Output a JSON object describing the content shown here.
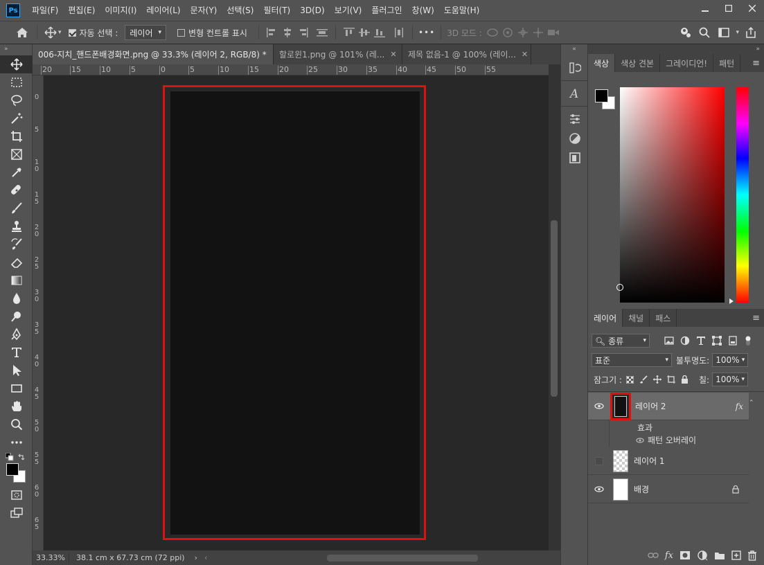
{
  "app": {
    "logo": "Ps"
  },
  "menu": [
    "파일(F)",
    "편집(E)",
    "이미지(I)",
    "레이어(L)",
    "문자(Y)",
    "선택(S)",
    "필터(T)",
    "3D(D)",
    "보기(V)",
    "플러그인",
    "창(W)",
    "도움말(H)"
  ],
  "options": {
    "auto_select_label": "자동 선택 :",
    "auto_select_checked": true,
    "auto_select_target": "레이어",
    "transform_label": "변형 컨트롤 표시",
    "transform_checked": false,
    "more_label": "•••",
    "mode_3d_label": "3D 모드 :"
  },
  "tabs": [
    {
      "title": "006-지치_핸드폰배경화면.png @ 33.3% (레이어 2, RGB/8) *",
      "active": true
    },
    {
      "title": "할로윈1.png @ 101% (레...",
      "active": false
    },
    {
      "title": "제목 없음-1 @ 100% (레이...",
      "active": false
    }
  ],
  "ruler_top": [
    "20",
    "15",
    "10",
    "5",
    "0",
    "5",
    "10",
    "15",
    "20",
    "25",
    "30",
    "35",
    "40",
    "45",
    "50",
    "55"
  ],
  "ruler_left": [
    "0",
    "5",
    "1 0",
    "1 5",
    "2 0",
    "2 5",
    "3 0",
    "3 5",
    "4 0",
    "4 5",
    "5 0",
    "5 5",
    "6 0",
    "6 5"
  ],
  "status": {
    "zoom": "33.33%",
    "size": "38.1 cm x 67.73 cm (72 ppi)"
  },
  "color_panel": {
    "tabs": [
      "색상",
      "색상 견본",
      "그레이디언!",
      "패턴"
    ],
    "foreground": "#000000",
    "background": "#ffffff"
  },
  "layers_panel": {
    "tabs": [
      "레이어",
      "채널",
      "패스"
    ],
    "filter_label": "종류",
    "blend_mode": "표준",
    "opacity_label": "불투명도:",
    "opacity_value": "100%",
    "lock_label": "잠그기 :",
    "fill_label": "칠:",
    "fill_value": "100%",
    "layers": [
      {
        "name": "레이어 2",
        "visible": true,
        "active": true,
        "fx": "fx"
      },
      {
        "name": "레이어 1",
        "visible": false,
        "active": false
      },
      {
        "name": "배경",
        "visible": true,
        "active": false,
        "locked": true
      }
    ],
    "effects_label": "효과",
    "effect_item": "패턴 오버레이"
  },
  "accent_color": "#e01010"
}
